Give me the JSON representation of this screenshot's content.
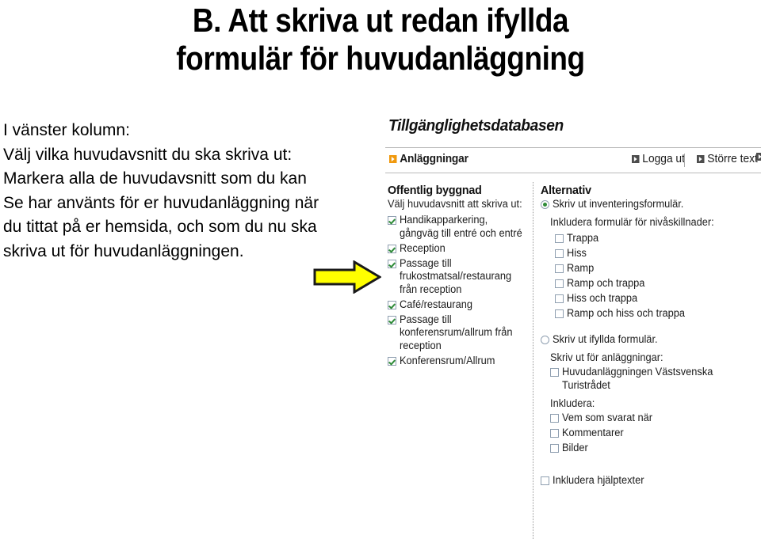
{
  "slide": {
    "title_lines": [
      "B. Att skriva ut redan ifyllda",
      "formulär för huvudanläggning"
    ],
    "body_lines": [
      "I vänster kolumn:",
      "Välj vilka huvudavsnitt du ska skriva ut:",
      "Markera alla de huvudavsnitt som du kan",
      "Se har använts för er huvudanläggning när",
      "du tittat på er hemsida, och som du nu ska",
      "skriva ut för huvudanläggningen."
    ],
    "arrow": {
      "name": "right-arrow",
      "fill": "#ffff00",
      "stroke": "#1a1a1a"
    }
  },
  "app": {
    "logo": "Tillgänglighetsdatabasen",
    "nav": [
      {
        "label": "Anläggningar",
        "icon": "orange-square-arrow-icon",
        "icon_color": "#f0990e"
      },
      {
        "label": "Logga ut",
        "icon": "gray-square-arrow-icon",
        "icon_color": "#4d4d4d"
      },
      {
        "label": "Större text",
        "icon": "gray-square-arrow-icon",
        "icon_color": "#4d4d4d"
      }
    ],
    "left_panel": {
      "heading": "Offentlig byggnad",
      "subheading": "Välj huvudavsnitt att skriva ut:",
      "items": [
        {
          "label": "Handikapparkering, gångväg till entré och entré",
          "checked": true
        },
        {
          "label": "Reception",
          "checked": true
        },
        {
          "label": "Passage till frukostmatsal/restaurang från reception",
          "checked": true
        },
        {
          "label": "Café/restaurang",
          "checked": true
        },
        {
          "label": "Passage till konferensrum/allrum från reception",
          "checked": true
        },
        {
          "label": "Konferensrum/Allrum",
          "checked": true
        }
      ]
    },
    "right_panel": {
      "heading": "Alternativ",
      "radio_inventory": {
        "label": "Skriv ut inventeringsformulär.",
        "selected": true
      },
      "level_diff_label": "Inkludera formulär för nivåskillnader:",
      "level_diff_items": [
        {
          "label": "Trappa",
          "checked": false
        },
        {
          "label": "Hiss",
          "checked": false
        },
        {
          "label": "Ramp",
          "checked": false
        },
        {
          "label": "Ramp och trappa",
          "checked": false
        },
        {
          "label": "Hiss och trappa",
          "checked": false
        },
        {
          "label": "Ramp och hiss och trappa",
          "checked": false
        }
      ],
      "radio_filled": {
        "label": "Skriv ut ifyllda formulär.",
        "selected": false
      },
      "facilities_label": "Skriv ut för anläggningar:",
      "facilities_items": [
        {
          "label": "Huvudanläggningen Västsvenska Turistrådet",
          "checked": false
        }
      ],
      "include_label": "Inkludera:",
      "include_items": [
        {
          "label": "Vem som svarat när",
          "checked": false
        },
        {
          "label": "Kommentarer",
          "checked": false
        },
        {
          "label": "Bilder",
          "checked": false
        }
      ],
      "help_text_item": {
        "label": "Inkludera hjälptexter",
        "checked": false
      }
    }
  }
}
